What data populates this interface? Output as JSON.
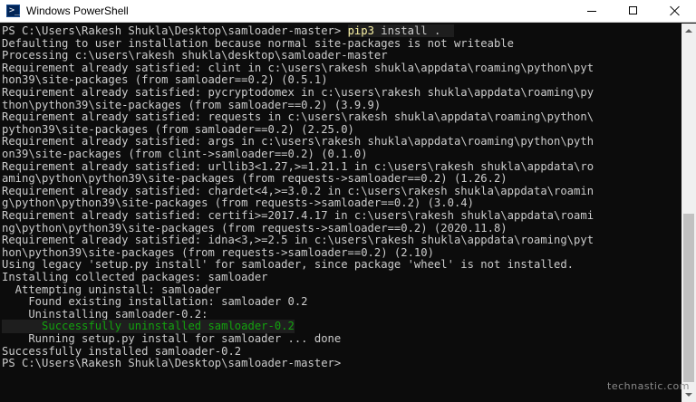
{
  "window": {
    "title": "Windows PowerShell",
    "icon": "powershell-icon",
    "icon_glyph": ">_",
    "controls": [
      "minimize-icon",
      "maximize-icon",
      "close-icon"
    ]
  },
  "console": {
    "prompt": "PS C:\\Users\\Rakesh Shukla\\Desktop\\samloader-master>",
    "command": "pip3",
    "command_args": "install .",
    "lines": [
      "Defaulting to user installation because normal site-packages is not writeable",
      "Processing c:\\users\\rakesh shukla\\desktop\\samloader-master",
      "Requirement already satisfied: clint in c:\\users\\rakesh shukla\\appdata\\roaming\\python\\pyt",
      "hon39\\site-packages (from samloader==0.2) (0.5.1)",
      "Requirement already satisfied: pycryptodomex in c:\\users\\rakesh shukla\\appdata\\roaming\\py",
      "thon\\python39\\site-packages (from samloader==0.2) (3.9.9)",
      "Requirement already satisfied: requests in c:\\users\\rakesh shukla\\appdata\\roaming\\python\\",
      "python39\\site-packages (from samloader==0.2) (2.25.0)",
      "Requirement already satisfied: args in c:\\users\\rakesh shukla\\appdata\\roaming\\python\\pyth",
      "on39\\site-packages (from clint->samloader==0.2) (0.1.0)",
      "Requirement already satisfied: urllib3<1.27,>=1.21.1 in c:\\users\\rakesh shukla\\appdata\\ro",
      "aming\\python\\python39\\site-packages (from requests->samloader==0.2) (1.26.2)",
      "Requirement already satisfied: chardet<4,>=3.0.2 in c:\\users\\rakesh shukla\\appdata\\roamin",
      "g\\python\\python39\\site-packages (from requests->samloader==0.2) (3.0.4)",
      "Requirement already satisfied: certifi>=2017.4.17 in c:\\users\\rakesh shukla\\appdata\\roami",
      "ng\\python\\python39\\site-packages (from requests->samloader==0.2) (2020.11.8)",
      "Requirement already satisfied: idna<3,>=2.5 in c:\\users\\rakesh shukla\\appdata\\roaming\\pyt",
      "hon\\python39\\site-packages (from requests->samloader==0.2) (2.10)",
      "Using legacy 'setup.py install' for samloader, since package 'wheel' is not installed.",
      "Installing collected packages: samloader",
      "  Attempting uninstall: samloader",
      "    Found existing installation: samloader 0.2",
      "    Uninstalling samloader-0.2:",
      "      Successfully uninstalled samloader-0.2",
      "    Running setup.py install for samloader ... done",
      "Successfully installed samloader-0.2"
    ],
    "final_prompt": "PS C:\\Users\\Rakesh Shukla\\Desktop\\samloader-master>"
  },
  "colors": {
    "background": "#0c0c0c",
    "text": "#cccccc",
    "command": "#f9f1a5",
    "success": "#13a10e"
  },
  "watermark": "technastic.com"
}
